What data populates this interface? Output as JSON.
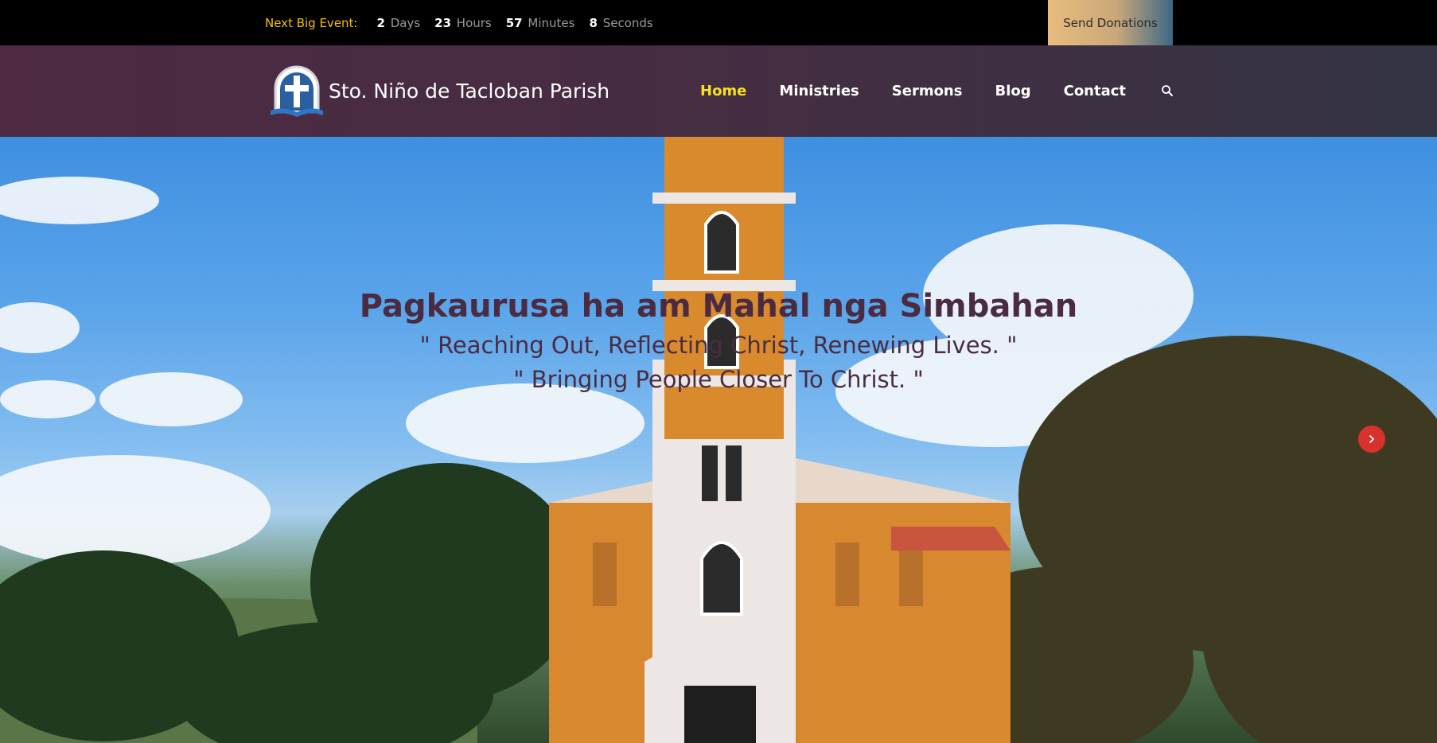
{
  "topbar": {
    "event_label": "Next Big Event:",
    "countdown": [
      {
        "value": "2",
        "unit": "Days"
      },
      {
        "value": "23",
        "unit": "Hours"
      },
      {
        "value": "57",
        "unit": "Minutes"
      },
      {
        "value": "8",
        "unit": "Seconds"
      }
    ],
    "donate_label": "Send Donations"
  },
  "header": {
    "site_title": "Sto. Niño de Tacloban Parish",
    "nav": [
      {
        "label": "Home",
        "active": true
      },
      {
        "label": "Ministries",
        "active": false
      },
      {
        "label": "Sermons",
        "active": false
      },
      {
        "label": "Blog",
        "active": false
      },
      {
        "label": "Contact",
        "active": false
      }
    ],
    "search_icon": "search-icon"
  },
  "hero": {
    "title": "Pagkaurusa ha am Mahal nga Simbahan",
    "subtitle_1": "\" Reaching Out, Reflecting Christ, Renewing Lives. \"",
    "subtitle_2": "\" Bringing People Closer To Christ. \"",
    "next_icon": "chevron-right-icon"
  },
  "colors": {
    "accent_yellow": "#f6e21c",
    "event_label": "#f2c200",
    "header_bg": "#4d2a41",
    "hero_text": "#4a2b42",
    "slider_button": "#d9322e"
  }
}
